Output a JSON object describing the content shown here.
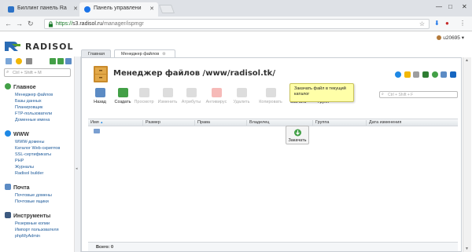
{
  "browser": {
    "tabs": [
      {
        "label": "Биллинг панель Ra"
      },
      {
        "label": "Панель управлени"
      }
    ],
    "url_prefix": "https://",
    "url_host": "s3.radisol.ru",
    "url_path": "/manager/ispmgr"
  },
  "app": {
    "logo_text": "RADISOL",
    "user": "u20695",
    "search_placeholder": "Ctrl + Shift + M"
  },
  "sidebar": {
    "sections": [
      {
        "title": "Главное",
        "items": [
          "Менеджер файлов",
          "Базы данных",
          "Планировщик",
          "FTP-пользователи",
          "Доменные имена"
        ]
      },
      {
        "title": "WWW",
        "items": [
          "WWW-домены",
          "Каталог Web-скриптов",
          "SSL-сертификаты",
          "PHP",
          "Журналы",
          "Radisol builder"
        ]
      },
      {
        "title": "Почта",
        "items": [
          "Почтовые домены",
          "Почтовые ящики"
        ]
      },
      {
        "title": "Инструменты",
        "items": [
          "Резервные копии",
          "Импорт пользователя",
          "phpMyAdmin"
        ]
      }
    ]
  },
  "main": {
    "tabs": [
      {
        "label": "Главная"
      },
      {
        "label": "Менеджер файлов"
      }
    ],
    "title": "Менеджер файлов /www/radisol.tk/",
    "toolbar": {
      "back": "Назад",
      "create": "Создать",
      "view": "Просмотр",
      "edit": "Изменить",
      "attributes": "Атрибуты",
      "antivirus": "Антивирус",
      "delete": "Удалить",
      "copy": "Копировать",
      "upload": "Скачать",
      "group": "Групп",
      "search_placeholder": "Ctrl + Shift + F"
    },
    "tooltip": "Закачать файл в текущий каталог",
    "download_popup": "Закачать",
    "columns": [
      "Имя",
      "Размер",
      "Права",
      "Владелец",
      "Группа",
      "Дата изменения"
    ],
    "sort_indicator": "▲",
    "footer_total": "Всего: 0"
  },
  "colors": {
    "link": "#1d5a9a",
    "tooltip_bg": "#ffffa8",
    "accent_green": "#4caf50"
  }
}
